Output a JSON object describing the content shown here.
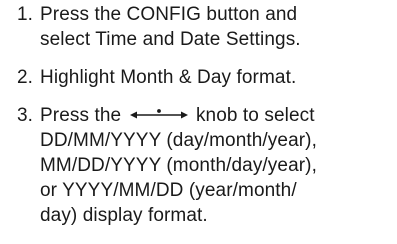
{
  "steps": [
    {
      "number": "1.",
      "lines": [
        "Press the CONFIG button and",
        "select Time and Date Settings."
      ]
    },
    {
      "number": "2.",
      "lines": [
        "Highlight Month & Day format."
      ]
    },
    {
      "number": "3.",
      "line1_before": "Press the",
      "line1_after": "knob to select",
      "icon": "knob-rotate-icon",
      "lines_rest": [
        "DD/MM/YYYY (day/month/year),",
        "MM/DD/YYYY (month/day/year),",
        "or YYYY/MM/DD (year/month/",
        "day) display format."
      ]
    }
  ]
}
